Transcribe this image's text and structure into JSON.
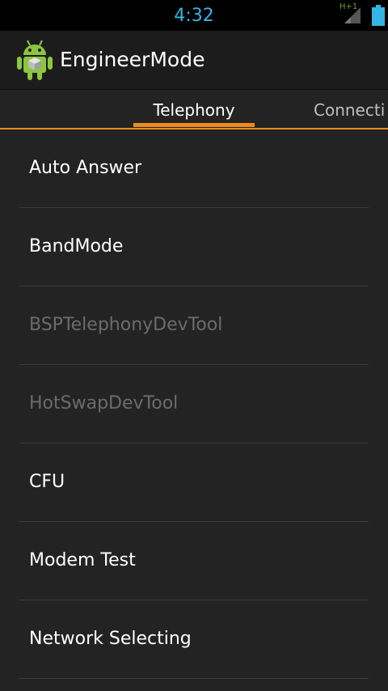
{
  "status_bar": {
    "time": "4:32",
    "network_type": "H+1",
    "signal_icon": "signal-icon",
    "battery_icon": "battery-icon"
  },
  "action_bar": {
    "app_icon": "android-icon",
    "title": "EngineerMode"
  },
  "tabs": [
    {
      "label": "Telephony",
      "selected": true
    },
    {
      "label": "Connecti",
      "selected": false
    }
  ],
  "list": {
    "items": [
      {
        "label": "Auto Answer",
        "enabled": true
      },
      {
        "label": "BandMode",
        "enabled": true
      },
      {
        "label": "BSPTelephonyDevTool",
        "enabled": false
      },
      {
        "label": "HotSwapDevTool",
        "enabled": false
      },
      {
        "label": "CFU",
        "enabled": true
      },
      {
        "label": "Modem Test",
        "enabled": true
      },
      {
        "label": "Network Selecting",
        "enabled": true
      }
    ]
  },
  "colors": {
    "accent": "#f08a1c",
    "clock": "#33b5e5",
    "background": "#232323",
    "disabled_text": "#6b6b6b"
  }
}
